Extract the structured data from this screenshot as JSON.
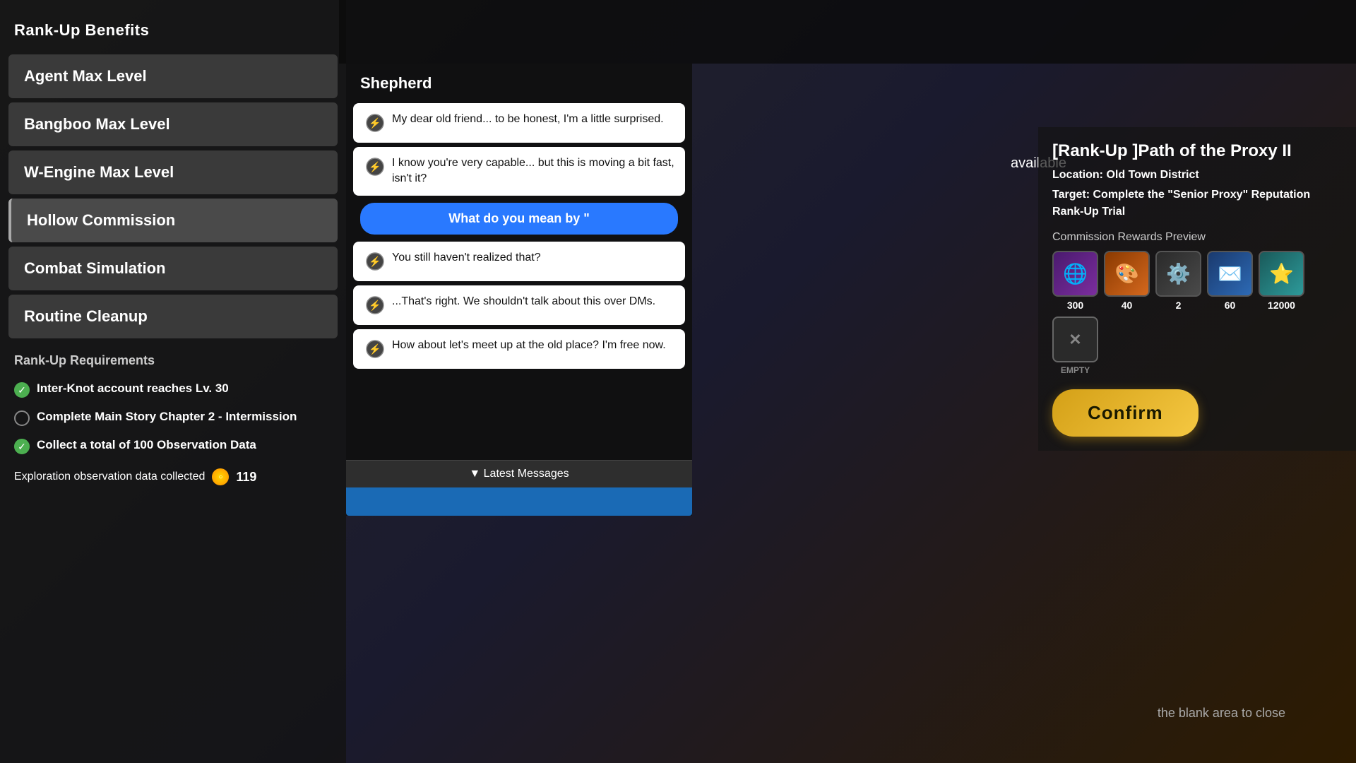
{
  "leftPanel": {
    "rankUpBenefitsTitle": "Rank-Up Benefits",
    "benefits": [
      {
        "label": "Agent Max Level",
        "active": false
      },
      {
        "label": "Bangboo Max Level",
        "active": false
      },
      {
        "label": "W-Engine Max Level",
        "active": false
      },
      {
        "label": "Hollow Commission",
        "active": true
      },
      {
        "label": "Combat Simulation",
        "active": false
      },
      {
        "label": "Routine Cleanup",
        "active": false
      }
    ],
    "rankUpRequirementsTitle": "Rank-Up Requirements",
    "requirements": [
      {
        "label": "Inter-Knot account reaches Lv. 30",
        "completed": true
      },
      {
        "label": "Complete Main Story Chapter 2 - Intermission",
        "completed": false
      },
      {
        "label": "Collect a total of 100 Observation Data",
        "completed": true
      }
    ],
    "explorationLabel": "Exploration observation data collected",
    "explorationValue": "119"
  },
  "chatPanel": {
    "speaker": "Shepherd",
    "messages": [
      {
        "type": "npc",
        "text": "My dear old friend... to be honest, I'm a little surprised."
      },
      {
        "type": "npc",
        "text": "I know you're very capable... but this is moving a bit fast, isn't it?"
      },
      {
        "type": "player",
        "text": "What do you mean by \""
      },
      {
        "type": "npc",
        "text": "You still haven't realized that?"
      },
      {
        "type": "npc",
        "text": "...That's right. We shouldn't talk about this over DMs."
      },
      {
        "type": "npc",
        "text": "How about let's meet up at the old place? I'm free now."
      }
    ],
    "latestMessagesBtn": "▼ Latest Messages"
  },
  "rightPanel": {
    "availableLabel": "available",
    "commissionTitle": "[Rank-Up ]Path of the Proxy II",
    "locationLabel": "Location:",
    "locationValue": "Old Town District",
    "targetLabel": "Target:",
    "targetValue": "Complete the \"Senior Proxy\" Reputation Rank-Up Trial",
    "rewardsTitle": "Commission Rewards Preview",
    "rewards": [
      {
        "type": "purple",
        "count": "300",
        "icon": "🌐"
      },
      {
        "type": "orange",
        "count": "40",
        "icon": "🎨"
      },
      {
        "type": "dark",
        "count": "2",
        "icon": "⚙️"
      },
      {
        "type": "blue",
        "count": "60",
        "icon": "✉️"
      },
      {
        "type": "teal",
        "count": "12000",
        "icon": "⭐"
      },
      {
        "type": "empty",
        "count": "EMPTY",
        "icon": "✕"
      }
    ],
    "confirmBtn": "Confirm"
  },
  "footer": {
    "closeAreaText": "the blank area to close"
  }
}
